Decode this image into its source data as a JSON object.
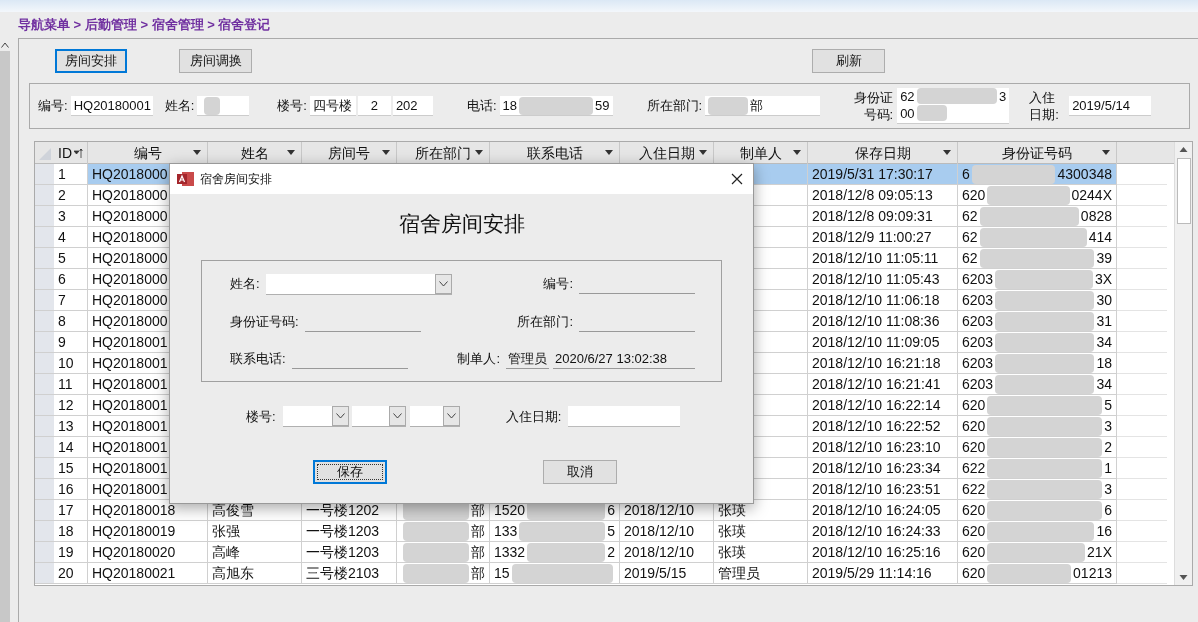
{
  "breadcrumb": "导航菜单 > 后勤管理 > 宿舍管理 > 宿舍登记",
  "toolbar": [
    {
      "label": "房间安排",
      "focused": true
    },
    {
      "label": "房间调换",
      "focused": false
    },
    {
      "label": "刷新",
      "focused": false
    }
  ],
  "info": {
    "code_label": "编号:",
    "code": "HQ20180001",
    "name_label": "姓名:",
    "building_label": "楼号:",
    "building": [
      "四号楼",
      "2",
      "202"
    ],
    "phone_label": "电话:",
    "phone": {
      "start": "18",
      "end": "59"
    },
    "dept_label": "所在部门:",
    "dept": {
      "end": "部"
    },
    "id_label": "身份证号码:",
    "id_card": {
      "start": "62",
      "end": "3",
      "line2": "00"
    },
    "checkin_label": "入住日期:",
    "checkin": "2019/5/14"
  },
  "table": {
    "columns": [
      {
        "label": "ID",
        "sorted": true
      },
      {
        "label": "编号",
        "sorted": false
      },
      {
        "label": "姓名",
        "sorted": false
      },
      {
        "label": "房间号",
        "sorted": false
      },
      {
        "label": "所在部门",
        "sorted": false
      },
      {
        "label": "联系电话",
        "sorted": false
      },
      {
        "label": "入住日期",
        "sorted": false
      },
      {
        "label": "制单人",
        "sorted": false
      },
      {
        "label": "保存日期",
        "sorted": false
      },
      {
        "label": "身份证号码",
        "sorted": false
      }
    ],
    "rows": [
      {
        "id": "1",
        "code": "HQ2018000",
        "save_date": "2019/5/31 17:30:17",
        "id_card": {
          "start": "6",
          "end": "4300348"
        },
        "selected": true
      },
      {
        "id": "2",
        "code": "HQ2018000",
        "save_date": "2018/12/8 09:05:13",
        "id_card": {
          "start": "620",
          "end": "0244X"
        },
        "selected": false
      },
      {
        "id": "3",
        "code": "HQ2018000",
        "save_date": "2018/12/8 09:09:31",
        "id_card": {
          "start": "62",
          "end": "0828"
        },
        "selected": false
      },
      {
        "id": "4",
        "code": "HQ2018000",
        "save_date": "2018/12/9 11:00:27",
        "id_card": {
          "start": "62",
          "end": "414"
        },
        "selected": false
      },
      {
        "id": "5",
        "code": "HQ2018000",
        "save_date": "2018/12/10 11:05:11",
        "id_card": {
          "start": "62",
          "end": "39"
        },
        "selected": false
      },
      {
        "id": "6",
        "code": "HQ2018000",
        "save_date": "2018/12/10 11:05:43",
        "id_card": {
          "start": "6203",
          "end": "3X"
        },
        "selected": false
      },
      {
        "id": "7",
        "code": "HQ2018000",
        "save_date": "2018/12/10 11:06:18",
        "id_card": {
          "start": "6203",
          "end": "30"
        },
        "selected": false
      },
      {
        "id": "8",
        "code": "HQ2018000",
        "save_date": "2018/12/10 11:08:36",
        "id_card": {
          "start": "6203",
          "end": "31"
        },
        "selected": false
      },
      {
        "id": "9",
        "code": "HQ2018001",
        "save_date": "2018/12/10 11:09:05",
        "id_card": {
          "start": "6203",
          "end": "34"
        },
        "selected": false
      },
      {
        "id": "10",
        "code": "HQ2018001",
        "save_date": "2018/12/10 16:21:18",
        "id_card": {
          "start": "6203",
          "end": "18"
        },
        "selected": false
      },
      {
        "id": "11",
        "code": "HQ2018001",
        "save_date": "2018/12/10 16:21:41",
        "id_card": {
          "start": "6203",
          "end": "34"
        },
        "selected": false
      },
      {
        "id": "12",
        "code": "HQ2018001",
        "save_date": "2018/12/10 16:22:14",
        "id_card": {
          "start": "620",
          "end": "5"
        },
        "selected": false
      },
      {
        "id": "13",
        "code": "HQ2018001",
        "save_date": "2018/12/10 16:22:52",
        "id_card": {
          "start": "620",
          "end": "3"
        },
        "selected": false
      },
      {
        "id": "14",
        "code": "HQ2018001",
        "save_date": "2018/12/10 16:23:10",
        "id_card": {
          "start": "620",
          "end": "2"
        },
        "selected": false
      },
      {
        "id": "15",
        "code": "HQ2018001",
        "save_date": "2018/12/10 16:23:34",
        "id_card": {
          "start": "622",
          "end": "1"
        },
        "selected": false
      },
      {
        "id": "16",
        "code": "HQ2018001",
        "save_date": "2018/12/10 16:23:51",
        "id_card": {
          "start": "622",
          "end": "3"
        },
        "selected": false
      },
      {
        "id": "17",
        "code": "HQ20180018",
        "name": "高俊雪",
        "room": "一号楼1202",
        "dept": {
          "end": "部"
        },
        "phone": {
          "start": "1520",
          "end": "6"
        },
        "check_in": "2018/12/10",
        "maker": "张瑛",
        "save_date": "2018/12/10 16:24:05",
        "id_card": {
          "start": "620",
          "end": "6"
        },
        "selected": false
      },
      {
        "id": "18",
        "code": "HQ20180019",
        "name": "张强",
        "room": "一号楼1203",
        "dept": {
          "end": "部"
        },
        "phone": {
          "start": "133",
          "end": "5"
        },
        "check_in": "2018/12/10",
        "maker": "张瑛",
        "save_date": "2018/12/10 16:24:33",
        "id_card": {
          "start": "620",
          "end": "16"
        },
        "selected": false
      },
      {
        "id": "19",
        "code": "HQ20180020",
        "name": "高峰",
        "room": "一号楼1203",
        "dept": {
          "end": "部"
        },
        "phone": {
          "start": "1332",
          "end": "2"
        },
        "check_in": "2018/12/10",
        "maker": "张瑛",
        "save_date": "2018/12/10 16:25:16",
        "id_card": {
          "start": "620",
          "end": "21X"
        },
        "selected": false
      },
      {
        "id": "20",
        "code": "HQ20180021",
        "name": "高旭东",
        "room": "三号楼2103",
        "dept": {
          "end": "部"
        },
        "phone": {
          "start": "15"
        },
        "check_in": "2019/5/15",
        "maker": "管理员",
        "save_date": "2019/5/29 11:14:16",
        "id_card": {
          "start": "620",
          "end": "01213"
        },
        "selected": false
      }
    ]
  },
  "dialog": {
    "title": "宿舍房间安排",
    "heading": "宿舍房间安排",
    "rows": [
      [
        {
          "label": "姓名:",
          "kind": "combo"
        },
        {
          "label": "编号:",
          "kind": "line"
        }
      ],
      [
        {
          "label": "身份证号码:",
          "kind": "line"
        },
        {
          "label": "所在部门:",
          "kind": "line"
        }
      ],
      [
        {
          "label": "联系电话:",
          "kind": "line"
        },
        {
          "label": "制单人:",
          "kind": "pair",
          "values": [
            "管理员",
            "2020/6/27 13:02:38"
          ]
        }
      ]
    ],
    "building_label": "楼号:",
    "checkin_label": "入住日期:",
    "buttons": [
      {
        "label": "保存",
        "focused": true
      },
      {
        "label": "取消",
        "focused": false
      }
    ]
  }
}
